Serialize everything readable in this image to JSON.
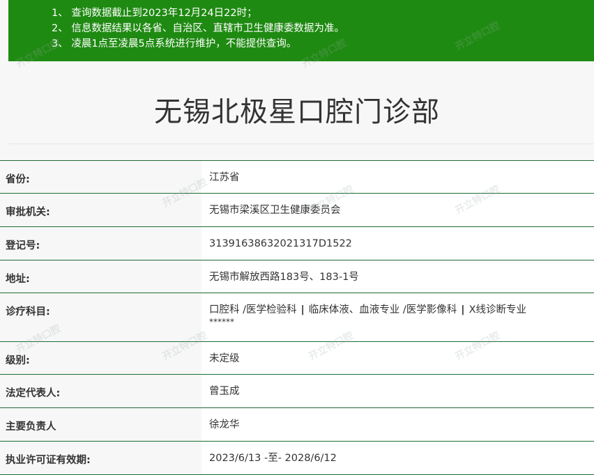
{
  "notice": {
    "lines": [
      "1、 查询数据截止到2023年12月24日22时；",
      "2、 信息数据结果以各省、自治区、直辖市卫生健康委数据为准。",
      "3、 凌晨1点至凌晨5点系统进行维护，不能提供查询。"
    ]
  },
  "title": "无锡北极星口腔门诊部",
  "rows": [
    {
      "label": "省份:",
      "value": "江苏省"
    },
    {
      "label": "审批机关:",
      "value": "无锡市梁溪区卫生健康委员会"
    },
    {
      "label": "登记号:",
      "value": "3139163863202131 7D1522"
    },
    {
      "label": "地址:",
      "value": "无锡市解放西路183号、183-1号"
    },
    {
      "label": "诊疗科目:",
      "value_parts": [
        "口腔科 /医学检验科",
        "临床体液、血液专业 /医学影像科",
        "X线诊断专业"
      ],
      "separator": "|",
      "extra": "******"
    },
    {
      "label": "级别:",
      "value": "未定级"
    },
    {
      "label": "法定代表人:",
      "value": "曾玉成"
    },
    {
      "label": "主要负责人",
      "value": "徐龙华"
    },
    {
      "label": "执业许可证有效期:",
      "value": "2023/6/13 -至- 2028/6/12"
    }
  ],
  "watermark": {
    "text": "开立特口腔"
  },
  "colors": {
    "notice_bg": "#1f8a12",
    "border": "#1f6b35"
  }
}
